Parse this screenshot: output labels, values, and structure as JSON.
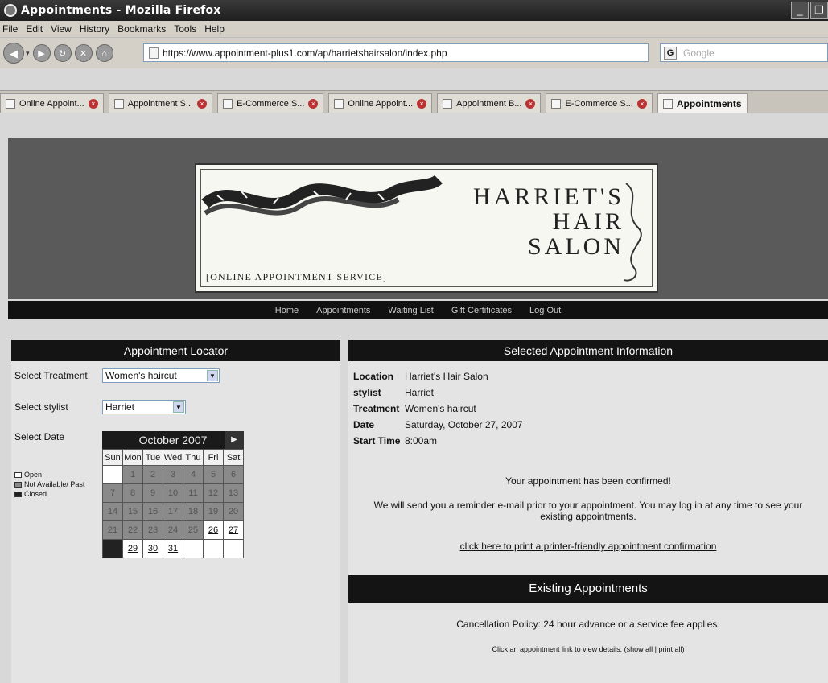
{
  "window": {
    "title": "Appointments - Mozilla Firefox"
  },
  "menu": [
    "File",
    "Edit",
    "View",
    "History",
    "Bookmarks",
    "Tools",
    "Help"
  ],
  "address": {
    "url": "https://www.appointment-plus1.com/ap/harrietshairsalon/index.php"
  },
  "search": {
    "placeholder": "Google",
    "engine_icon": "G"
  },
  "tabs": [
    {
      "label": "Online Appoint..."
    },
    {
      "label": "Appointment S..."
    },
    {
      "label": "E-Commerce S..."
    },
    {
      "label": "Online Appoint..."
    },
    {
      "label": "Appointment B..."
    },
    {
      "label": "E-Commerce S..."
    },
    {
      "label": "Appointments"
    }
  ],
  "logo": {
    "name_line1": "HARRIET'S",
    "name_line2": "HAIR",
    "name_line3": "SALON",
    "tagline": "[ONLINE APPOINTMENT SERVICE]"
  },
  "nav": [
    "Home",
    "Appointments",
    "Waiting List",
    "Gift Certificates",
    "Log Out"
  ],
  "locator": {
    "title": "Appointment Locator",
    "treatment_label": "Select Treatment",
    "treatment_value": "Women's haircut",
    "stylist_label": "Select stylist",
    "stylist_value": "Harriet",
    "date_label": "Select Date",
    "legend": [
      "Open",
      "Not Available/ Past",
      "Closed"
    ]
  },
  "calendar": {
    "month": "October 2007",
    "weekdays": [
      "Sun",
      "Mon",
      "Tue",
      "Wed",
      "Thu",
      "Fri",
      "Sat"
    ],
    "weeks": [
      [
        {
          "d": "",
          "s": "empty"
        },
        {
          "d": "1",
          "s": "na"
        },
        {
          "d": "2",
          "s": "na"
        },
        {
          "d": "3",
          "s": "na"
        },
        {
          "d": "4",
          "s": "na"
        },
        {
          "d": "5",
          "s": "na"
        },
        {
          "d": "6",
          "s": "na"
        }
      ],
      [
        {
          "d": "7",
          "s": "na"
        },
        {
          "d": "8",
          "s": "na"
        },
        {
          "d": "9",
          "s": "na"
        },
        {
          "d": "10",
          "s": "na"
        },
        {
          "d": "11",
          "s": "na"
        },
        {
          "d": "12",
          "s": "na"
        },
        {
          "d": "13",
          "s": "na"
        }
      ],
      [
        {
          "d": "14",
          "s": "na"
        },
        {
          "d": "15",
          "s": "na"
        },
        {
          "d": "16",
          "s": "na"
        },
        {
          "d": "17",
          "s": "na"
        },
        {
          "d": "18",
          "s": "na"
        },
        {
          "d": "19",
          "s": "na"
        },
        {
          "d": "20",
          "s": "na"
        }
      ],
      [
        {
          "d": "21",
          "s": "na"
        },
        {
          "d": "22",
          "s": "na"
        },
        {
          "d": "23",
          "s": "na"
        },
        {
          "d": "24",
          "s": "na"
        },
        {
          "d": "25",
          "s": "na"
        },
        {
          "d": "26",
          "s": "open"
        },
        {
          "d": "27",
          "s": "open"
        }
      ],
      [
        {
          "d": "",
          "s": "closed"
        },
        {
          "d": "29",
          "s": "open"
        },
        {
          "d": "30",
          "s": "open"
        },
        {
          "d": "31",
          "s": "open"
        },
        {
          "d": "",
          "s": "empty"
        },
        {
          "d": "",
          "s": "empty"
        },
        {
          "d": "",
          "s": "empty"
        }
      ]
    ]
  },
  "selected": {
    "title": "Selected Appointment Information",
    "location_label": "Location",
    "location_value": "Harriet's Hair Salon",
    "stylist_label": "stylist",
    "stylist_value": "Harriet",
    "treatment_label": "Treatment",
    "treatment_value": "Women's haircut",
    "date_label": "Date",
    "date_value": "Saturday, October 27, 2007",
    "start_label": "Start Time",
    "start_value": "8:00am",
    "confirmed": "Your appointment has been confirmed!",
    "reminder": "We will send you a reminder e-mail prior to your appointment. You may log in at any time to see your existing appointments.",
    "print_link": "click here to print a printer-friendly appointment confirmation"
  },
  "existing": {
    "title": "Existing Appointments",
    "policy": "Cancellation Policy: 24 hour advance or a service fee applies.",
    "hint": "Click an appointment link to view details. (show all | print all)"
  }
}
